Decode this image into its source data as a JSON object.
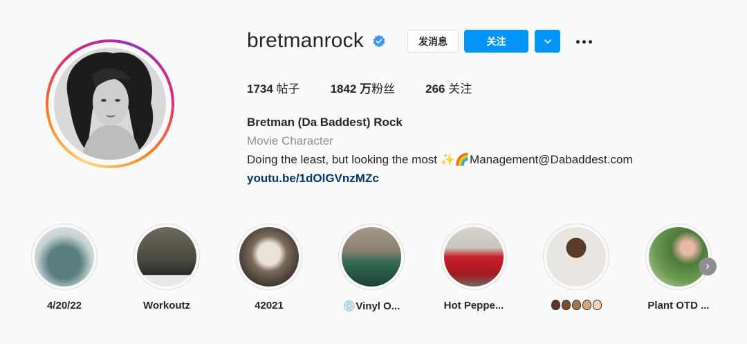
{
  "profile": {
    "username": "bretmanrock",
    "verified": true,
    "buttons": {
      "message": "发消息",
      "follow": "关注"
    },
    "stats": {
      "posts_count": "1734",
      "posts_label": " 帖子",
      "followers_count": "1842 万",
      "followers_label": "粉丝",
      "following_count": "266",
      "following_label": " 关注"
    },
    "bio": {
      "name": "Bretman (Da Baddest) Rock",
      "category": "Movie Character",
      "text": "Doing the least, but looking the most ✨🌈Management@Dabaddest.com",
      "link": "youtu.be/1dOlGVnzMZc"
    }
  },
  "highlights": [
    {
      "label": "4/20/22"
    },
    {
      "label": "Workoutz"
    },
    {
      "label": "42021"
    },
    {
      "label": "💿Vinyl O..."
    },
    {
      "label": "Hot Peppe..."
    },
    {
      "label": "🏿🏾🏽🏼🏻"
    },
    {
      "label": "Plant OTD ..."
    }
  ],
  "colors": {
    "accent": "#0095f6",
    "link": "#00376b",
    "muted": "#8e8e8e"
  },
  "icons": [
    "verified-badge-icon",
    "chevron-down-icon",
    "more-options-icon",
    "next-arrow-icon"
  ]
}
